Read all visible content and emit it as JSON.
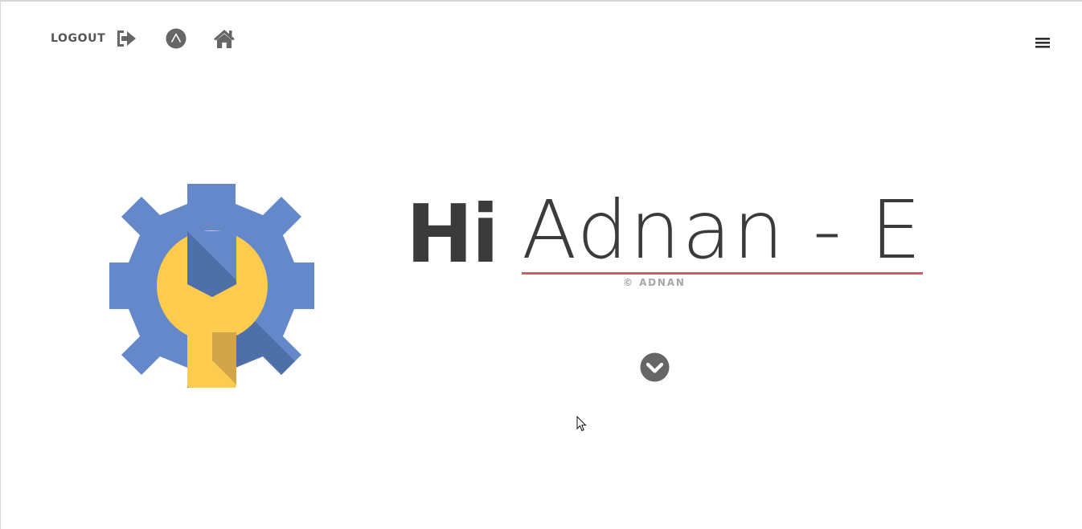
{
  "nav": {
    "logout_label": "LOGOUT",
    "icons": [
      "sign-out-icon",
      "circle-a-icon",
      "home-icon",
      "hamburger-menu-icon"
    ]
  },
  "hero": {
    "greeting": "Hi",
    "name": "Adnan - E",
    "copyright": "© ADNAN",
    "logo_icon": "gear-wrench-settings-logo"
  },
  "colors": {
    "gear_blue": "#6488c9",
    "gear_shadow": "#4f6fa8",
    "wrench_yellow": "#fdcc4f",
    "wrench_shadow": "#d1a548",
    "underline_accent": "#e05468",
    "text_dark": "#3b3b3b",
    "icon_gray": "#666666"
  }
}
